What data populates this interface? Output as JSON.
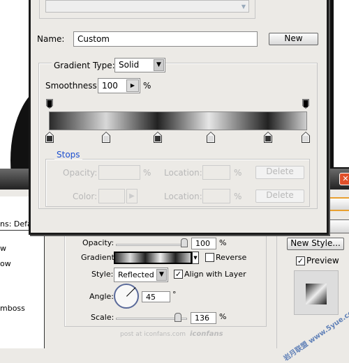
{
  "gradient_editor": {
    "name_label": "Name:",
    "name_value": "Custom",
    "new_button": "New",
    "gradient_type_label": "Gradient Type:",
    "gradient_type_value": "Solid",
    "smoothness_label": "Smoothness:",
    "smoothness_value": "100",
    "smoothness_unit": "%",
    "stops_group_label": "Stops",
    "opacity_label": "Opacity:",
    "opacity_unit": "%",
    "location_label_1": "Location:",
    "location_unit_1": "%",
    "delete_button_1": "Delete",
    "color_label": "Color:",
    "location_label_2": "Location:",
    "location_unit_2": "%",
    "delete_button_2": "Delete",
    "color_stops": [
      "dark",
      "light",
      "dark",
      "light",
      "dark",
      "light"
    ],
    "accent_color": "#1c4fd0"
  },
  "layer_style": {
    "presets_fragment": "ns: Defau",
    "styles_list": [
      "w",
      "ow",
      "",
      "mboss"
    ],
    "opacity_label": "Opacity:",
    "opacity_value": "100",
    "opacity_unit": "%",
    "gradient_label": "Gradient:",
    "reverse_label": "Reverse",
    "reverse_checked": false,
    "style_label": "Style:",
    "style_value": "Reflected",
    "align_label": "Align with Layer",
    "align_checked": true,
    "angle_label": "Angle:",
    "angle_value": "45",
    "angle_unit": "°",
    "scale_label": "Scale:",
    "scale_value": "136",
    "scale_unit": "%",
    "new_style_button": "New Style...",
    "preview_label": "Preview",
    "preview_checked": true,
    "footer_text": "post at iconfans.com",
    "footer_logo": "iconfans",
    "watermark": "岩月联盟 www.5yue.com"
  }
}
